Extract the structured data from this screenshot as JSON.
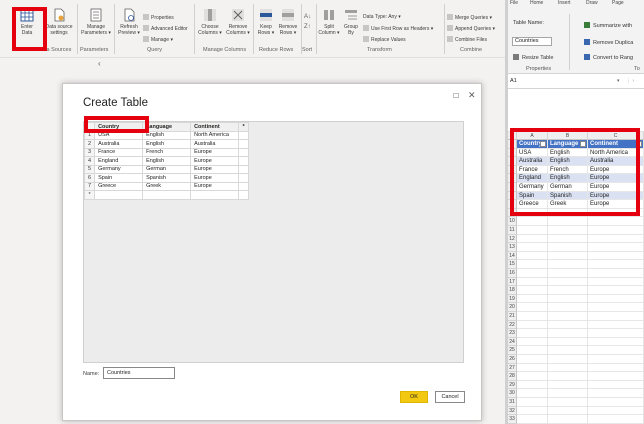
{
  "pq": {
    "ribbon": {
      "enter_data": {
        "line1": "Enter",
        "line2": "Data"
      },
      "data_source_settings": {
        "line1": "Data source",
        "line2": "settings"
      },
      "manage_parameters": {
        "line1": "Manage",
        "line2": "Parameters ▾"
      },
      "refresh_preview": {
        "line1": "Refresh",
        "line2": "Preview ▾"
      },
      "properties": "Properties",
      "advanced_editor": "Advanced Editor",
      "manage": "Manage ▾",
      "choose_columns": {
        "line1": "Choose",
        "line2": "Columns ▾"
      },
      "remove_columns": {
        "line1": "Remove",
        "line2": "Columns ▾"
      },
      "keep_rows": {
        "line1": "Keep",
        "line2": "Rows ▾"
      },
      "remove_rows": {
        "line1": "Remove",
        "line2": "Rows ▾"
      },
      "split_column": {
        "line1": "Split",
        "line2": "Column ▾"
      },
      "group_by": {
        "line1": "Group",
        "line2": "By"
      },
      "data_type": "Data Type: Any ▾",
      "use_first_row": "Use First Row as Headers ▾",
      "replace_values": "Replace Values",
      "merge_queries": "Merge Queries ▾",
      "append_queries": "Append Queries ▾",
      "combine_files": "Combine Files",
      "groups": {
        "data_sources": "Data Sources",
        "parameters": "Parameters",
        "query": "Query",
        "manage_columns": "Manage Columns",
        "reduce_rows": "Reduce Rows",
        "sort": "Sort",
        "transform": "Transform",
        "combine": "Combine"
      }
    },
    "collapse_chevron": "‹",
    "dialog": {
      "title": "Create Table",
      "maximize": "☐",
      "close": "✕",
      "columns": [
        "Country",
        "Language",
        "Continent"
      ],
      "add_column": "*",
      "rows": [
        {
          "num": "1",
          "country": "USA",
          "language": "English",
          "continent": "North America"
        },
        {
          "num": "2",
          "country": "Australia",
          "language": "English",
          "continent": "Australia"
        },
        {
          "num": "3",
          "country": "France",
          "language": "French",
          "continent": "Europe"
        },
        {
          "num": "4",
          "country": "England",
          "language": "English",
          "continent": "Europe"
        },
        {
          "num": "5",
          "country": "Germany",
          "language": "German",
          "continent": "Europe"
        },
        {
          "num": "6",
          "country": "Spain",
          "language": "Spanish",
          "continent": "Europe"
        },
        {
          "num": "7",
          "country": "Greece",
          "language": "Greek",
          "continent": "Europe"
        }
      ],
      "new_row_marker": "*",
      "name_label": "Name:",
      "name_value": "Countries",
      "ok_label": "OK",
      "cancel_label": "Cancel"
    }
  },
  "xl": {
    "tabs": [
      "File",
      "Home",
      "Insert",
      "Draw",
      "Page"
    ],
    "table_name_label": "Table Name:",
    "table_name_value": "Countries",
    "resize_table": "Resize Table",
    "properties_group": "Properties",
    "summarize": "Summarize with",
    "remove_duplicates": "Remove Duplica",
    "convert_to_range": "Convert to Rang",
    "tools_group": "To",
    "name_box": "A1",
    "name_box_arrow": "▾",
    "fx_sep": "⋮ ›",
    "col_headers": [
      "",
      "A",
      "B",
      "C"
    ],
    "table_headers": [
      "Country",
      "Language",
      "Continent"
    ],
    "table_rows": [
      [
        "USA",
        "English",
        "North America"
      ],
      [
        "Australia",
        "English",
        "Australia"
      ],
      [
        "France",
        "French",
        "Europe"
      ],
      [
        "England",
        "English",
        "Europe"
      ],
      [
        "Germany",
        "German",
        "Europe"
      ],
      [
        "Spain",
        "Spanish",
        "Europe"
      ],
      [
        "Greece",
        "Greek",
        "Europe"
      ]
    ],
    "row_numbers": [
      "1",
      "2",
      "3",
      "4",
      "5",
      "6",
      "7",
      "8",
      "9",
      "10",
      "11",
      "12",
      "13",
      "14",
      "15",
      "16",
      "17",
      "18",
      "19",
      "20",
      "21",
      "22",
      "23",
      "24",
      "25",
      "26",
      "27",
      "28",
      "29",
      "30",
      "31",
      "32",
      "33"
    ]
  },
  "colors": {
    "highlight": "#e4000f",
    "excel_table_header": "#4472c4",
    "excel_band": "#d9e1f2",
    "ok_button": "#f2c811"
  }
}
